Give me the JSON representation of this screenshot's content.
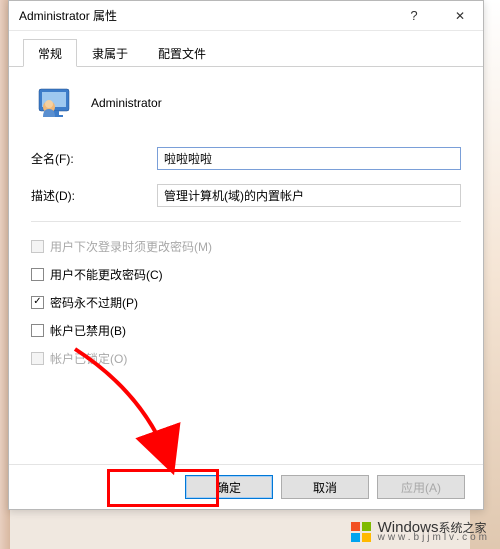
{
  "window": {
    "title": "Administrator 属性",
    "help": "?",
    "close": "✕"
  },
  "tabs": {
    "active": "常规",
    "t1": "隶属于",
    "t2": "配置文件"
  },
  "header": {
    "username": "Administrator"
  },
  "form": {
    "fullname_label": "全名(F):",
    "fullname_value": "啦啦啦啦",
    "desc_label": "描述(D):",
    "desc_value": "管理计算机(域)的内置帐户"
  },
  "checks": {
    "c0": {
      "label": "用户下次登录时须更改密码(M)",
      "checked": false,
      "disabled": true
    },
    "c1": {
      "label": "用户不能更改密码(C)",
      "checked": false,
      "disabled": false
    },
    "c2": {
      "label": "密码永不过期(P)",
      "checked": true,
      "disabled": false
    },
    "c3": {
      "label": "帐户已禁用(B)",
      "checked": false,
      "disabled": false
    },
    "c4": {
      "label": "帐户已锁定(O)",
      "checked": false,
      "disabled": true
    }
  },
  "buttons": {
    "ok": "确定",
    "cancel": "取消",
    "apply": "应用(A)"
  },
  "watermark": {
    "brand": "Windows",
    "sub": "系统之家",
    "url": "www.bjjmlv.com"
  }
}
